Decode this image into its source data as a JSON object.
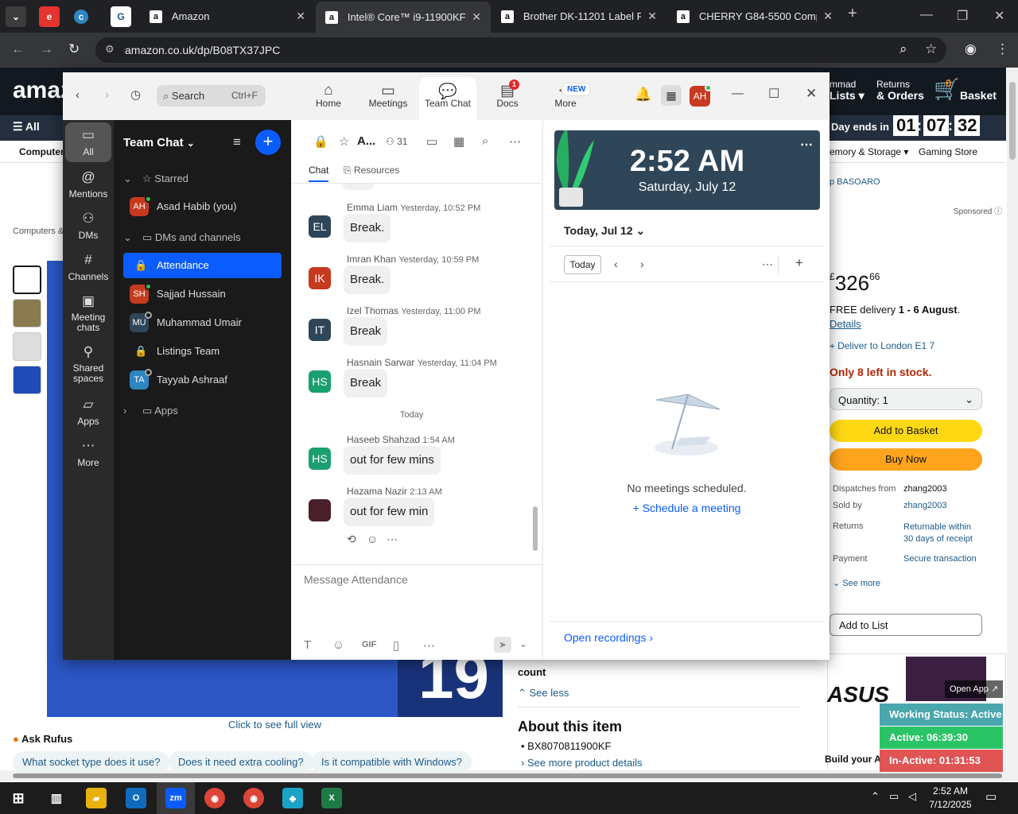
{
  "browser": {
    "tabs": [
      {
        "icon": "a",
        "title": "Amazon"
      },
      {
        "icon": "a",
        "title": "Intel® Core™ i9-11900KF De"
      },
      {
        "icon": "a",
        "title": "Brother DK-11201 Label Roll"
      },
      {
        "icon": "a",
        "title": "CHERRY G84-5500 Compact"
      }
    ],
    "url": "amazon.co.uk/dp/B08TX37JPC"
  },
  "amazon": {
    "logo": "amaz",
    "account": "mmad",
    "lists": "Lists",
    "returns": "Returns",
    "orders": "& Orders",
    "basket_count": "0",
    "basket": "Basket",
    "all": "All",
    "deal_label": "Day ends in",
    "countdown": [
      "01",
      "07",
      "32"
    ],
    "nav_left": "Computers",
    "nav_right1": "emory & Storage",
    "nav_right2": "Gaming Store",
    "brand_link": "p BASOARO",
    "sponsored": "Sponsored",
    "breadcrumb": "Computers &",
    "price_symbol": "£",
    "price": "326",
    "price_frac": "66",
    "delivery": "FREE delivery",
    "delivery_dates": "1 - 6 August",
    "details": "Details",
    "deliver_to": "Deliver to London E1 7",
    "stock": "Only 8 left in stock.",
    "quantity": "Quantity: 1",
    "add_basket": "Add to Basket",
    "buy_now": "Buy Now",
    "dispatch_label": "Dispatches from",
    "dispatch_value": "zhang2003",
    "sold_label": "Sold by",
    "sold_value": "zhang2003",
    "returns_label": "Returns",
    "returns_value": "Returnable within 30 days of receipt",
    "payment_label": "Payment",
    "payment_value": "Secure transaction",
    "see_more": "See more",
    "add_list": "Add to List",
    "count_label": "count",
    "see_less": "See less",
    "about_title": "About this item",
    "bullet": "BX8070811900KF",
    "see_details": "See more product details",
    "full_view": "Click to see full view",
    "rufus": "Ask Rufus",
    "rufus_qs": [
      "What socket type does it use?",
      "Does it need extra cooling?",
      "Is it compatible with Windows?"
    ],
    "hero_number": "19",
    "open_app": "Open App",
    "ad_title": "Build your A"
  },
  "zoom": {
    "search_placeholder": "Search",
    "search_shortcut": "Ctrl+F",
    "topnav": [
      {
        "label": "Home",
        "icon": "home-icon"
      },
      {
        "label": "Meetings",
        "icon": "video-icon"
      },
      {
        "label": "Team Chat",
        "icon": "chat-icon"
      },
      {
        "label": "Docs",
        "icon": "docs-icon",
        "badge": "1"
      },
      {
        "label": "More",
        "icon": "more-icon",
        "badge": "NEW"
      }
    ],
    "avatar": "AH",
    "rail": [
      {
        "label": "All",
        "icon": "chat-bubble-icon"
      },
      {
        "label": "Mentions",
        "icon": "at-icon"
      },
      {
        "label": "DMs",
        "icon": "people-icon"
      },
      {
        "label": "Channels",
        "icon": "hash-icon"
      },
      {
        "label": "Meeting chats",
        "icon": "calendar-chat-icon"
      },
      {
        "label": "Shared spaces",
        "icon": "share-icon"
      },
      {
        "label": "Apps",
        "icon": "apps-icon"
      },
      {
        "label": "More",
        "icon": "ellipsis-icon"
      }
    ],
    "sidebar": {
      "title": "Team Chat",
      "starred": "Starred",
      "me": {
        "initials": "AH",
        "name": "Asad Habib (you)"
      },
      "dms_section": "DMs and channels",
      "items": [
        {
          "name": "Attendance",
          "type": "lock"
        },
        {
          "initials": "SH",
          "name": "Sajjad Hussain",
          "color": "#c63a1f"
        },
        {
          "initials": "MU",
          "name": "Muhammad Umair",
          "color": "#2f4658"
        },
        {
          "name": "Listings Team",
          "type": "lock"
        },
        {
          "initials": "TA",
          "name": "Tayyab Ashraaf",
          "color": "#2e86c1"
        }
      ],
      "apps": "Apps"
    },
    "chat": {
      "channel_abbr": "A...",
      "member_count": "31",
      "tabs": [
        "Chat",
        "Resources"
      ],
      "today": "Today",
      "messages": [
        {
          "initials": "EL",
          "name": "Emma Liam",
          "time": "Yesterday, 10:52 PM",
          "text": "Break.",
          "color": "#2f4658"
        },
        {
          "initials": "IK",
          "name": "Imran Khan",
          "time": "Yesterday, 10:59 PM",
          "text": "Break.",
          "color": "#c63a1f"
        },
        {
          "initials": "IT",
          "name": "Izel Thomas",
          "time": "Yesterday, 11:00 PM",
          "text": "Break",
          "color": "#2f4658"
        },
        {
          "initials": "HS",
          "name": "Hasnain Sarwar",
          "time": "Yesterday, 11:04 PM",
          "text": "Break",
          "color": "#1a9f6f"
        },
        {
          "initials": "HS",
          "name": "Haseeb Shahzad",
          "time": "1:54 AM",
          "text": "out for few mins",
          "color": "#1a9f6f"
        },
        {
          "initials": "",
          "name": "Hazama Nazir",
          "time": "2:13 AM",
          "text": "out for few min",
          "color": "#4a1f2a"
        }
      ],
      "compose_placeholder": "Message Attendance",
      "gif": "GIF"
    },
    "calendar": {
      "time": "2:52 AM",
      "date": "Saturday, July 12",
      "day_picker": "Today, Jul 12",
      "today_btn": "Today",
      "empty": "No meetings scheduled.",
      "schedule": "Schedule a meeting",
      "recordings": "Open recordings"
    }
  },
  "working_status": {
    "status": "Working Status: Active",
    "active": "Active: 06:39:30",
    "inactive": "In-Active: 01:31:53"
  },
  "taskbar": {
    "time": "2:52 AM",
    "date": "7/12/2025"
  }
}
